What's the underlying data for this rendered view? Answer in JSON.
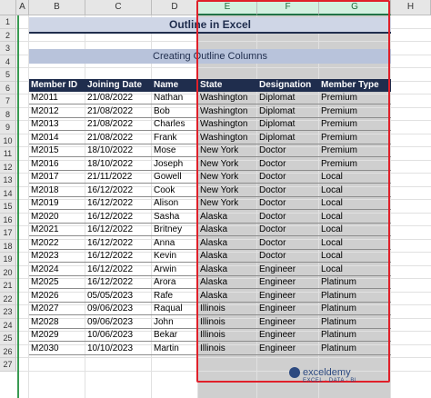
{
  "columns": [
    "A",
    "B",
    "C",
    "D",
    "E",
    "F",
    "G",
    "H"
  ],
  "rows": [
    "1",
    "2",
    "3",
    "4",
    "5",
    "6",
    "7",
    "8",
    "9",
    "10",
    "11",
    "12",
    "13",
    "14",
    "15",
    "16",
    "17",
    "18",
    "19",
    "20",
    "21",
    "22",
    "23",
    "24",
    "25",
    "26",
    "27"
  ],
  "title": "Outline in Excel",
  "subtitle": "Creating Outline Columns",
  "table": {
    "headers": [
      "Member ID",
      "Joining Date",
      "Name",
      "State",
      "Designation",
      "Member Type"
    ],
    "rows": [
      [
        "M2011",
        "21/08/2022",
        "Nathan",
        "Washington",
        "Diplomat",
        "Premium"
      ],
      [
        "M2012",
        "21/08/2022",
        "Bob",
        "Washington",
        "Diplomat",
        "Premium"
      ],
      [
        "M2013",
        "21/08/2022",
        "Charles",
        "Washington",
        "Diplomat",
        "Premium"
      ],
      [
        "M2014",
        "21/08/2022",
        "Frank",
        "Washington",
        "Diplomat",
        "Premium"
      ],
      [
        "M2015",
        "18/10/2022",
        "Mose",
        "New York",
        "Doctor",
        "Premium"
      ],
      [
        "M2016",
        "18/10/2022",
        "Joseph",
        "New York",
        "Doctor",
        "Premium"
      ],
      [
        "M2017",
        "21/11/2022",
        "Gowell",
        "New York",
        "Doctor",
        "Local"
      ],
      [
        "M2018",
        "16/12/2022",
        "Cook",
        "New York",
        "Doctor",
        "Local"
      ],
      [
        "M2019",
        "16/12/2022",
        "Alison",
        "New York",
        "Doctor",
        "Local"
      ],
      [
        "M2020",
        "16/12/2022",
        "Sasha",
        "Alaska",
        "Doctor",
        "Local"
      ],
      [
        "M2021",
        "16/12/2022",
        "Britney",
        "Alaska",
        "Doctor",
        "Local"
      ],
      [
        "M2022",
        "16/12/2022",
        "Anna",
        "Alaska",
        "Doctor",
        "Local"
      ],
      [
        "M2023",
        "16/12/2022",
        "Kevin",
        "Alaska",
        "Doctor",
        "Local"
      ],
      [
        "M2024",
        "16/12/2022",
        "Arwin",
        "Alaska",
        "Engineer",
        "Local"
      ],
      [
        "M2025",
        "16/12/2022",
        "Arora",
        "Alaska",
        "Engineer",
        "Platinum"
      ],
      [
        "M2026",
        "05/05/2023",
        "Rafe",
        "Alaska",
        "Engineer",
        "Platinum"
      ],
      [
        "M2027",
        "09/06/2023",
        "Raqual",
        "Illinois",
        "Engineer",
        "Platinum"
      ],
      [
        "M2028",
        "09/06/2023",
        "John",
        "Illinois",
        "Engineer",
        "Platinum"
      ],
      [
        "M2029",
        "10/06/2023",
        "Bekar",
        "Illinois",
        "Engineer",
        "Platinum"
      ],
      [
        "M2030",
        "10/10/2023",
        "Martin",
        "Illinois",
        "Engineer",
        "Platinum"
      ]
    ]
  },
  "watermark": {
    "name": "exceldemy",
    "tagline": "EXCEL · DATA · BI"
  },
  "colors": {
    "header_bg": "#1f2d4d",
    "selection": "#cfcfcf",
    "highlight_border": "#e0202a",
    "outline_bar": "#3a9a52"
  }
}
